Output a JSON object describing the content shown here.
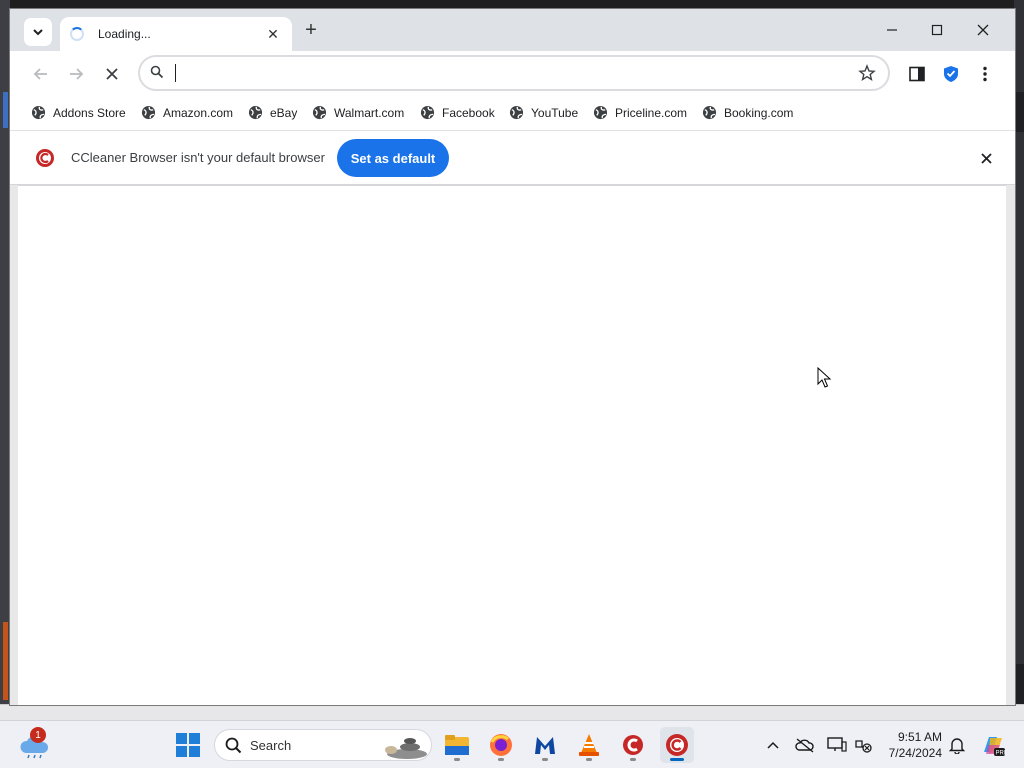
{
  "tab": {
    "title": "Loading..."
  },
  "omnibox": {
    "value": "",
    "placeholder": ""
  },
  "bookmarks": [
    "Addons Store",
    "Amazon.com",
    "eBay",
    "Walmart.com",
    "Facebook",
    "YouTube",
    "Priceline.com",
    "Booking.com"
  ],
  "infobar": {
    "message": "CCleaner Browser isn't your default browser",
    "button": "Set as default"
  },
  "taskbar": {
    "search_label": "Search",
    "weather_badge": "1",
    "time": "9:51 AM",
    "date": "7/24/2024"
  },
  "colors": {
    "accent": "#1a73e8",
    "taskbar_active": "#0067c0"
  }
}
